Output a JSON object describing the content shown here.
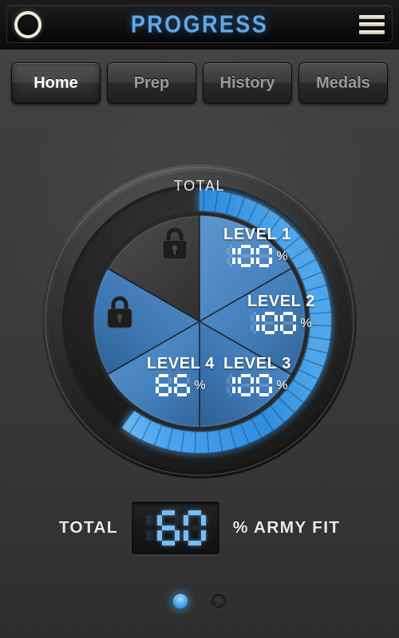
{
  "header": {
    "title": "PROGRESS",
    "logo_icon": "circle-ring-icon",
    "menu_icon": "hamburger-menu-icon"
  },
  "tabs": [
    {
      "label": "Home",
      "active": true
    },
    {
      "label": "Prep",
      "active": false
    },
    {
      "label": "History",
      "active": false
    },
    {
      "label": "Medals",
      "active": false
    }
  ],
  "gauge": {
    "total_label": "TOTAL",
    "arc_percent": 60,
    "lock_icon": "padlock-icon",
    "segments": [
      {
        "name": "LEVEL 1",
        "value": "100",
        "unit": "%",
        "locked": false
      },
      {
        "name": "LEVEL 2",
        "value": "100",
        "unit": "%",
        "locked": false
      },
      {
        "name": "LEVEL 3",
        "value": "100",
        "unit": "%",
        "locked": false
      },
      {
        "name": "LEVEL 4",
        "value": "66",
        "unit": "%",
        "locked": false
      },
      {
        "name": "",
        "value": "",
        "unit": "",
        "locked": true
      },
      {
        "name": "",
        "value": "",
        "unit": "",
        "locked": true
      }
    ]
  },
  "readout": {
    "prefix_label": "TOTAL",
    "value": "60",
    "digits": "_60",
    "suffix_label": "% ARMY FIT"
  },
  "pagination": {
    "count": 2,
    "active_index": 0
  },
  "colors": {
    "accent_blue": "#5fa8e8",
    "pie_blue": "#3f7cb8",
    "arc_blue": "#4fa8ef",
    "lcd_blue": "#78bdf2",
    "background": "#3b3b3b",
    "header_bg": "#101010"
  },
  "chart_data": {
    "type": "pie",
    "title": "TOTAL",
    "categories": [
      "LEVEL 1",
      "LEVEL 2",
      "LEVEL 3",
      "LEVEL 4",
      "LOCKED",
      "LOCKED"
    ],
    "values": [
      100,
      100,
      100,
      66,
      0,
      0
    ],
    "unit": "%",
    "slice_share_deg": 60,
    "locked": [
      false,
      false,
      false,
      false,
      true,
      true
    ],
    "ring": {
      "type": "arc",
      "value": 60,
      "max": 100,
      "start_deg": 0,
      "sweep_deg": 216
    },
    "total": 60,
    "total_label": "% ARMY FIT",
    "legend": "none"
  }
}
